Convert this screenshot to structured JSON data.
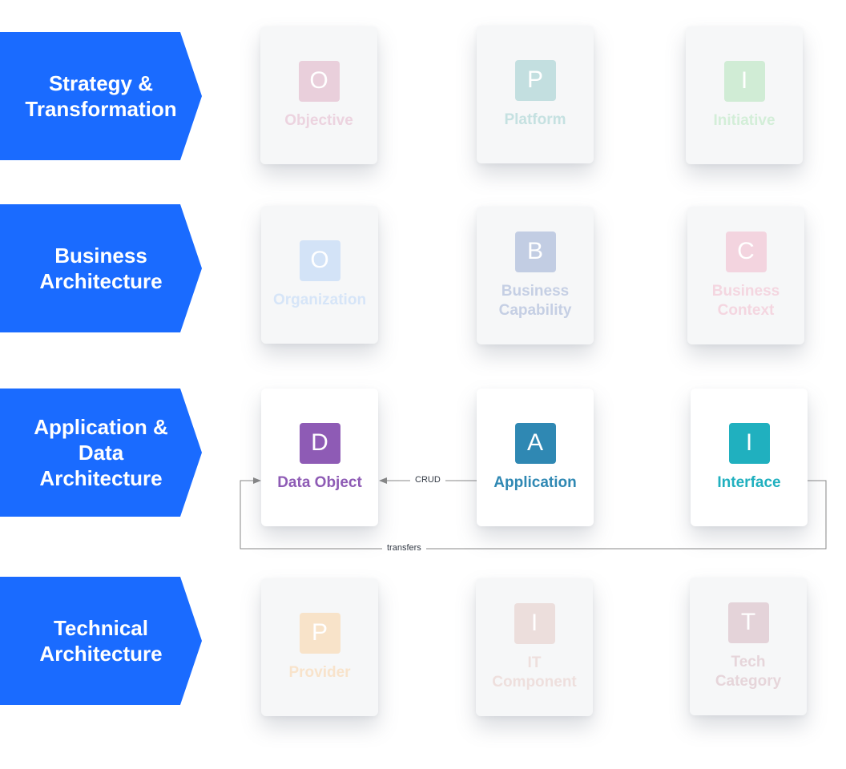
{
  "layers": [
    {
      "label": "Strategy &\nTransformation"
    },
    {
      "label": "Business\nArchitecture"
    },
    {
      "label": "Application &\nData\nArchitecture"
    },
    {
      "label": "Technical\nArchitecture"
    }
  ],
  "cards": {
    "objective": {
      "letter": "O",
      "label": "Objective",
      "color": "#e9cfdb",
      "text_color": "#ecd3df",
      "faded": true
    },
    "platform": {
      "letter": "P",
      "label": "Platform",
      "color": "#c3dfe0",
      "text_color": "#c5e1e1",
      "faded": true
    },
    "initiative": {
      "letter": "I",
      "label": "Initiative",
      "color": "#d0ecd5",
      "text_color": "#d3eed8",
      "faded": true
    },
    "organization": {
      "letter": "O",
      "label": "Organization",
      "color": "#d3e3f7",
      "text_color": "#d6e5f8",
      "faded": true
    },
    "capability": {
      "letter": "B",
      "label": "Business\nCapability",
      "color": "#c2cde3",
      "text_color": "#c5cfe4",
      "faded": true
    },
    "context": {
      "letter": "C",
      "label": "Business\nContext",
      "color": "#f3d4df",
      "text_color": "#f4d6e0",
      "faded": true
    },
    "data_object": {
      "letter": "D",
      "label": "Data Object",
      "color": "#8e5bb5",
      "text_color": "#8e5bb5",
      "faded": false
    },
    "application": {
      "letter": "A",
      "label": "Application",
      "color": "#2f88b3",
      "text_color": "#2f88b3",
      "faded": false
    },
    "interface": {
      "letter": "I",
      "label": "Interface",
      "color": "#20b0bf",
      "text_color": "#20b0bf",
      "faded": false
    },
    "provider": {
      "letter": "P",
      "label": "Provider",
      "color": "#f8e3c9",
      "text_color": "#f8e3cb",
      "faded": true
    },
    "it_component": {
      "letter": "I",
      "label": "IT\nComponent",
      "color": "#ecdedc",
      "text_color": "#eedfdd",
      "faded": true
    },
    "tech_category": {
      "letter": "T",
      "label": "Tech\nCategory",
      "color": "#e4d3d9",
      "text_color": "#e6d5da",
      "faded": true
    }
  },
  "edges": {
    "crud": "CRUD",
    "transfers": "transfers"
  },
  "colors": {
    "layer_blue": "#1a6bff",
    "edge_gray": "#888888"
  }
}
